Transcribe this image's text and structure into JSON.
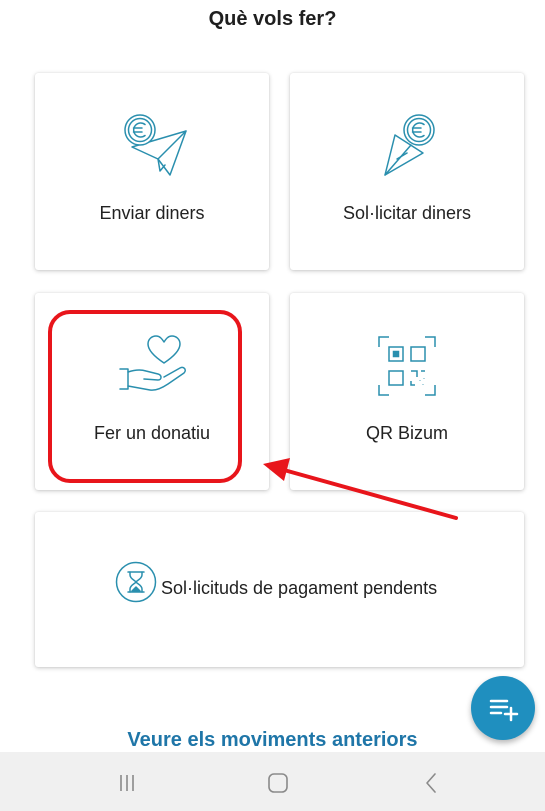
{
  "header": {
    "title": "Què vols fer?"
  },
  "actions": {
    "send": {
      "label": "Enviar diners",
      "icon": "send-money-icon"
    },
    "request": {
      "label": "Sol·licitar diners",
      "icon": "request-money-icon"
    },
    "donate": {
      "label": "Fer un donatiu",
      "icon": "donation-heart-hand-icon"
    },
    "qr": {
      "label": "QR Bizum",
      "icon": "qr-code-icon"
    },
    "pending": {
      "label": "Sol·licituds de pagament pendents",
      "icon": "hourglass-icon"
    }
  },
  "history_link": {
    "label": "Veure els moviments anteriors"
  },
  "fab": {
    "icon": "add-list-icon"
  },
  "nav_bar": {
    "items": [
      "recents-icon",
      "home-icon",
      "back-icon"
    ]
  },
  "colors": {
    "accent": "#1f8fbf",
    "link": "#1f76a8",
    "icon_stroke": "#2a8fae",
    "highlight": "#e8151b"
  }
}
